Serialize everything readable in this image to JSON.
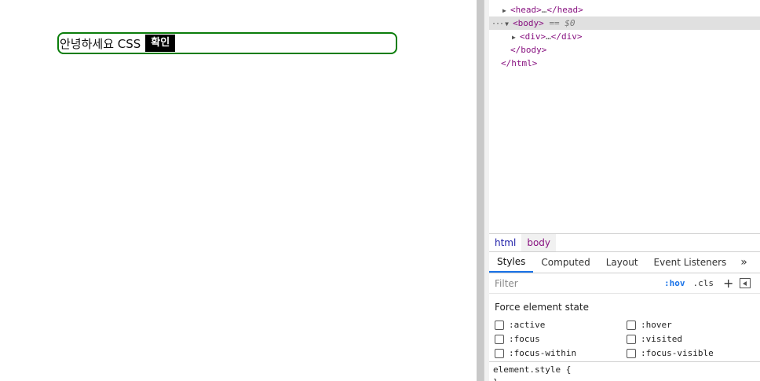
{
  "page": {
    "text": "안녕하세요 CSS",
    "button_label": "확인"
  },
  "devtools": {
    "dom_tree": {
      "head_line": {
        "open": "<head>",
        "ellipsis": "…",
        "close": "</head>"
      },
      "body_line": {
        "prefix": "···",
        "open": "<body>",
        "ref": "== $0"
      },
      "div_line": {
        "open": "<div>",
        "ellipsis": "…",
        "close": "</div>"
      },
      "body_close": "</body>",
      "html_close": "</html>"
    },
    "breadcrumb": [
      "html",
      "body"
    ],
    "tabs": [
      "Styles",
      "Computed",
      "Layout",
      "Event Listeners"
    ],
    "tabs_more": "»",
    "filter": {
      "placeholder": "Filter",
      "hov": ":hov",
      "cls": ".cls",
      "plus": "+"
    },
    "force_state": {
      "title": "Force element state",
      "left": [
        ":active",
        ":focus",
        ":focus-within"
      ],
      "right": [
        ":hover",
        ":visited",
        ":focus-visible"
      ]
    },
    "style_rule": {
      "selector": "element.style {",
      "close": "}"
    }
  }
}
